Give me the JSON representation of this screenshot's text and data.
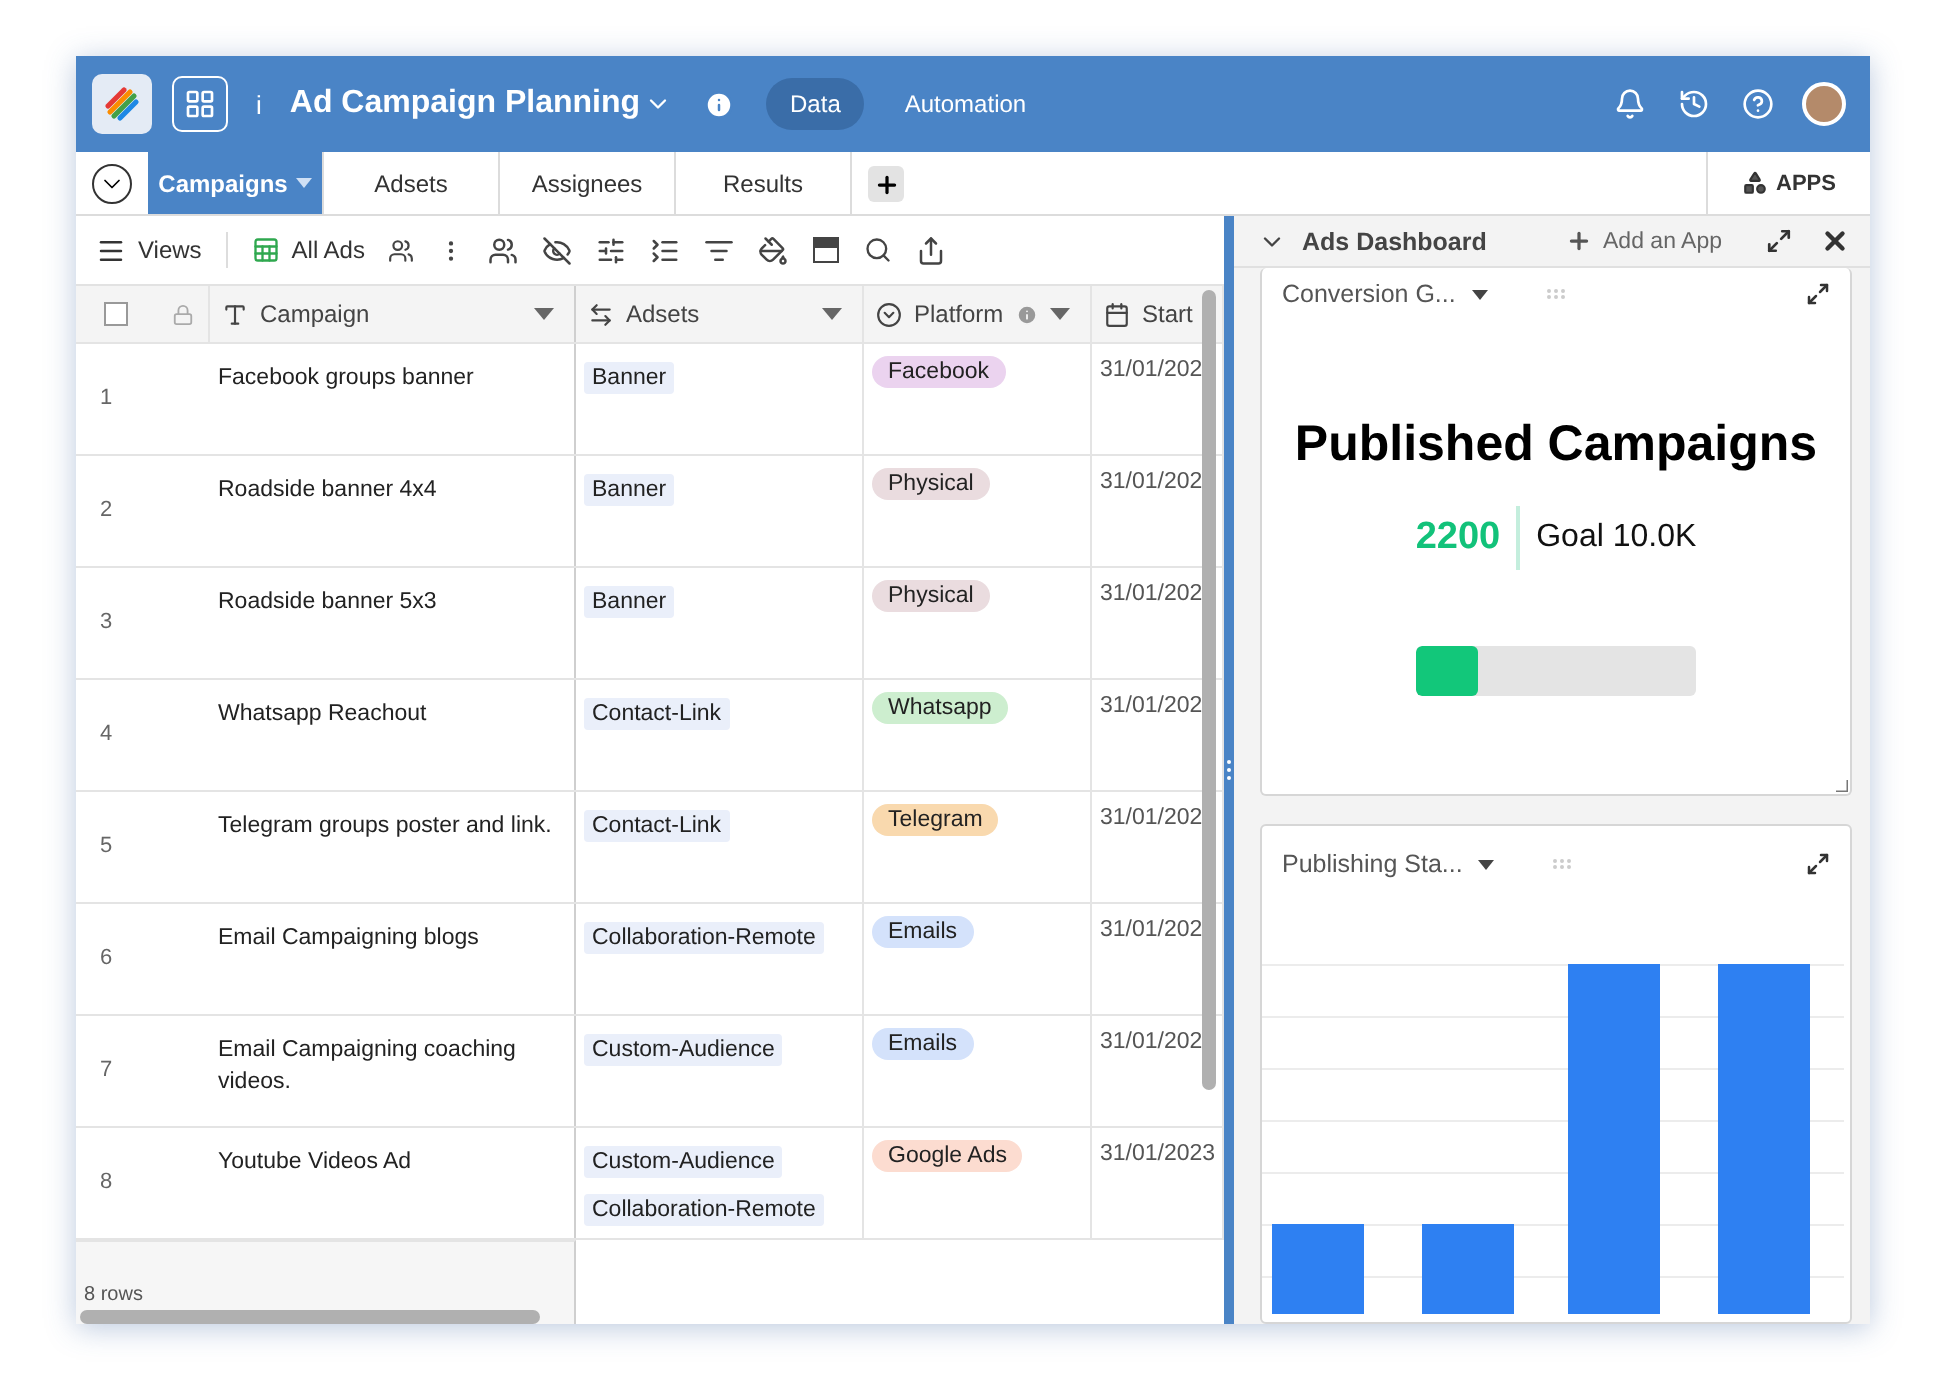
{
  "header": {
    "info_label": "i",
    "title": "Ad Campaign Planning",
    "nav": [
      {
        "label": "Data",
        "selected": true
      },
      {
        "label": "Automation",
        "selected": false
      }
    ]
  },
  "tabs": [
    {
      "label": "Campaigns",
      "selected": true
    },
    {
      "label": "Adsets",
      "selected": false
    },
    {
      "label": "Assignees",
      "selected": false
    },
    {
      "label": "Results",
      "selected": false
    }
  ],
  "apps_button": "APPS",
  "toolbar": {
    "views": "Views",
    "view_name": "All Ads"
  },
  "table": {
    "select_all_checked": false,
    "columns": [
      "Campaign",
      "Adsets",
      "Platform",
      "Start"
    ],
    "rows": [
      {
        "number": "1",
        "campaign": "Facebook groups banner",
        "adsets": [
          "Banner"
        ],
        "platform": {
          "label": "Facebook",
          "color": "#ebd3ef"
        },
        "start": "31/01/202"
      },
      {
        "number": "2",
        "campaign": "Roadside banner 4x4",
        "adsets": [
          "Banner"
        ],
        "platform": {
          "label": "Physical",
          "color": "#eadcdf"
        },
        "start": "31/01/202"
      },
      {
        "number": "3",
        "campaign": "Roadside banner 5x3",
        "adsets": [
          "Banner"
        ],
        "platform": {
          "label": "Physical",
          "color": "#eadcdf"
        },
        "start": "31/01/202"
      },
      {
        "number": "4",
        "campaign": "Whatsapp Reachout",
        "adsets": [
          "Contact-Link"
        ],
        "platform": {
          "label": "Whatsapp",
          "color": "#cdeecf"
        },
        "start": "31/01/202"
      },
      {
        "number": "5",
        "campaign": "Telegram groups poster and link.",
        "adsets": [
          "Contact-Link"
        ],
        "platform": {
          "label": "Telegram",
          "color": "#f9d9ae"
        },
        "start": "31/01/202"
      },
      {
        "number": "6",
        "campaign": "Email Campaigning blogs",
        "adsets": [
          "Collaboration-Remote"
        ],
        "platform": {
          "label": "Emails",
          "color": "#d4e2fb"
        },
        "start": "31/01/202"
      },
      {
        "number": "7",
        "campaign": "Email Campaigning coaching videos.",
        "adsets": [
          "Custom-Audience"
        ],
        "platform": {
          "label": "Emails",
          "color": "#d4e2fb"
        },
        "start": "31/01/202"
      },
      {
        "number": "8",
        "campaign": "Youtube Videos Ad",
        "adsets": [
          "Custom-Audience",
          "Collaboration-Remote"
        ],
        "platform": {
          "label": "Google Ads",
          "color": "#fcdcd0"
        },
        "start": "31/01/2023"
      }
    ]
  },
  "footer": {
    "row_count": "8 rows"
  },
  "dashboard": {
    "title": "Ads Dashboard",
    "add_app": "Add an App",
    "widgets": [
      {
        "kind": "goal",
        "title": "Conversion G...",
        "heading": "Published Campaigns",
        "value": "2200",
        "goal": "Goal 10.0K",
        "level": 0.22
      },
      {
        "kind": "bars",
        "title": "Publishing Sta..."
      }
    ]
  }
}
